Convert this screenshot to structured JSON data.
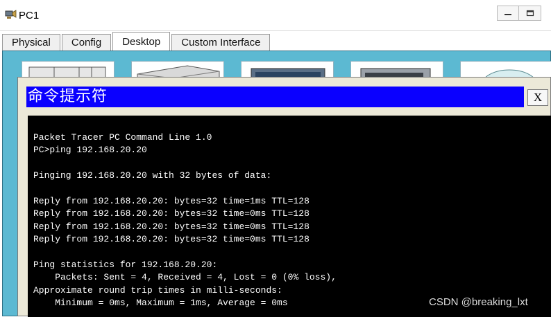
{
  "window": {
    "title": "PC1",
    "controls": {
      "minimize": "minimize-icon",
      "restore": "restore-icon"
    }
  },
  "tabs": [
    {
      "label": "Physical",
      "active": false
    },
    {
      "label": "Config",
      "active": false
    },
    {
      "label": "Desktop",
      "active": true
    },
    {
      "label": "Custom Interface",
      "active": false
    }
  ],
  "desktop": {
    "background_color": "#5cb9d2",
    "app_icons": [
      "ip-configuration-icon",
      "dial-up-icon",
      "terminal-icon",
      "command-prompt-icon",
      "web-browser-icon"
    ]
  },
  "command_prompt": {
    "title": "命令提示符",
    "close_label": "X",
    "title_color": "#0a00ff",
    "lines": [
      "Packet Tracer PC Command Line 1.0",
      "PC>ping 192.168.20.20",
      "",
      "Pinging 192.168.20.20 with 32 bytes of data:",
      "",
      "Reply from 192.168.20.20: bytes=32 time=1ms TTL=128",
      "Reply from 192.168.20.20: bytes=32 time=0ms TTL=128",
      "Reply from 192.168.20.20: bytes=32 time=0ms TTL=128",
      "Reply from 192.168.20.20: bytes=32 time=0ms TTL=128",
      "",
      "Ping statistics for 192.168.20.20:",
      "    Packets: Sent = 4, Received = 4, Lost = 0 (0% loss),",
      "Approximate round trip times in milli-seconds:",
      "    Minimum = 0ms, Maximum = 1ms, Average = 0ms"
    ]
  },
  "watermark": "CSDN @breaking_lxt"
}
